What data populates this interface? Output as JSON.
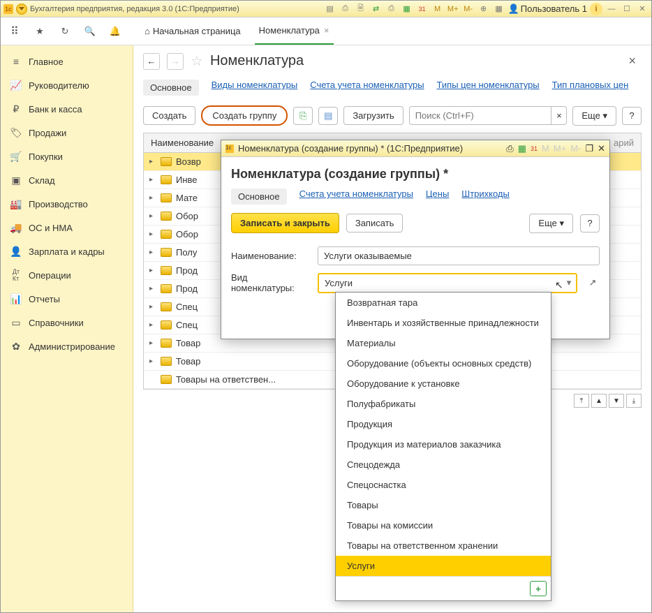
{
  "app": {
    "title": "Бухгалтерия предприятия, редакция 3.0  (1С:Предприятие)",
    "user": "Пользователь 1"
  },
  "tabs": {
    "home": "Начальная страница",
    "nomen": "Номенклатура"
  },
  "sidebar": {
    "items": [
      {
        "label": "Главное"
      },
      {
        "label": "Руководителю"
      },
      {
        "label": "Банк и касса"
      },
      {
        "label": "Продажи"
      },
      {
        "label": "Покупки"
      },
      {
        "label": "Склад"
      },
      {
        "label": "Производство"
      },
      {
        "label": "ОС и НМА"
      },
      {
        "label": "Зарплата и кадры"
      },
      {
        "label": "Операции"
      },
      {
        "label": "Отчеты"
      },
      {
        "label": "Справочники"
      },
      {
        "label": "Администрирование"
      }
    ]
  },
  "page": {
    "title": "Номенклатура"
  },
  "subtabs": {
    "main": "Основное",
    "kinds": "Виды номенклатуры",
    "accounts": "Счета учета номенклатуры",
    "price_types": "Типы цен номенклатуры",
    "plan_type": "Тип плановых цен"
  },
  "actions": {
    "create": "Создать",
    "create_group": "Создать группу",
    "load": "Загрузить",
    "more": "Еще",
    "search_ph": "Поиск (Ctrl+F)"
  },
  "list": {
    "header": "Наименование",
    "truncated_hint": "арий",
    "rows": [
      "Возвр",
      "Инве",
      "Мате",
      "Обор",
      "Обор",
      "Полу",
      "Прод",
      "Прод",
      "Спец",
      "Спец",
      "Товар",
      "Товар",
      "Товары на ответствен..."
    ]
  },
  "dialog": {
    "window_title": "Номенклатура (создание группы) * (1С:Предприятие)",
    "title": "Номенклатура (создание группы) *",
    "subtabs": {
      "main": "Основное",
      "accounts": "Счета учета номенклатуры",
      "prices": "Цены",
      "barcodes": "Штрихкоды"
    },
    "save_close": "Записать и закрыть",
    "save": "Записать",
    "more": "Еще",
    "name_label": "Наименование:",
    "name_value": "Услуги оказываемые",
    "kind_label": "Вид номенклатуры:",
    "kind_value": "Услуги"
  },
  "dropdown": {
    "items": [
      "Возвратная тара",
      "Инвентарь и хозяйственные принадлежности",
      "Материалы",
      "Оборудование (объекты основных средств)",
      "Оборудование к установке",
      "Полуфабрикаты",
      "Продукция",
      "Продукция из материалов заказчика",
      "Спецодежда",
      "Спецоснастка",
      "Товары",
      "Товары на комиссии",
      "Товары на ответственном хранении",
      "Услуги"
    ],
    "selected": "Услуги"
  }
}
